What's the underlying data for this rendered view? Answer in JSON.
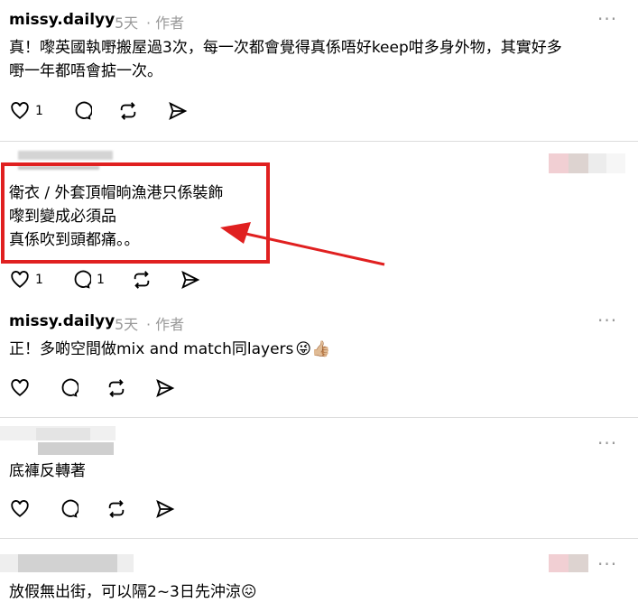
{
  "comments": [
    {
      "author": "missy.dailyy",
      "time": "5天",
      "badge": "· 作者",
      "text_lines": [
        "真！嚟英國執嘢搬屋過3次，每一次都會覺得真係唔好keep咁多身外物，其實好多",
        "嘢一年都唔會掂一次。"
      ],
      "like_count": "1"
    },
    {
      "author": "",
      "text_lines": [
        "衛衣 / 外套頂帽晌漁港只係裝飾",
        "嚟到變成必須品",
        "真係吹到頭都痛。。"
      ],
      "like_count": "1",
      "reply_count": "1"
    },
    {
      "author": "missy.dailyy",
      "time": "5天",
      "badge": "· 作者",
      "text_lines": [
        "正！多啲空間做mix and match同layers"
      ],
      "emoji": [
        "😜",
        "👍🏼"
      ]
    },
    {
      "author": "",
      "text_lines": [
        "底褲反轉著"
      ]
    },
    {
      "author": "",
      "text_lines": [
        "放假無出街，可以隔2~3日先沖涼"
      ],
      "emoji": [
        "😖"
      ]
    }
  ],
  "more_label": "···",
  "colors": {
    "annotation": "#e02020",
    "meta": "#999999",
    "divider": "#dcdcdc"
  }
}
